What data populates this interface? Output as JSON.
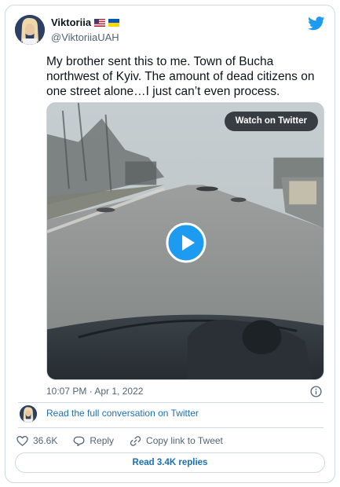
{
  "author": {
    "display_name": "Viktoriia",
    "handle": "@ViktoriiaUAH",
    "flags": [
      "us-flag-icon",
      "ukraine-flag-icon"
    ]
  },
  "tweet": {
    "text": "My brother sent this to me. Town of Bucha northwest of Kyiv. The amount of dead citizens on one street alone…I just can’t even process.",
    "timestamp": "10:07 PM · Apr 1, 2022"
  },
  "media": {
    "watch_label": "Watch on Twitter",
    "play_icon": "play-icon"
  },
  "conversation": {
    "link_text": "Read the full conversation on Twitter"
  },
  "actions": {
    "likes": "36.6K",
    "reply_label": "Reply",
    "copy_label": "Copy link to Tweet"
  },
  "replies_button": "Read 3.4K replies",
  "colors": {
    "twitter_blue": "#1d9bf0",
    "link_blue": "#1d6fb3",
    "border": "#cfd9de",
    "muted_text": "#536471"
  }
}
